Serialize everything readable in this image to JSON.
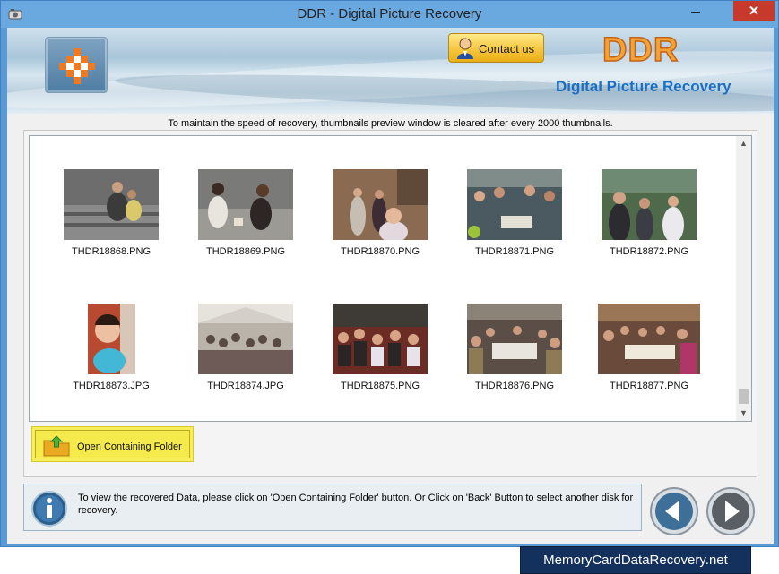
{
  "window": {
    "title": "DDR - Digital Picture Recovery",
    "close_glyph": "✕"
  },
  "banner": {
    "contact_label": "Contact us",
    "brand": "DDR",
    "subtitle": "Digital Picture Recovery"
  },
  "notice": "To maintain the speed of recovery, thumbnails preview window is cleared after every 2000 thumbnails.",
  "thumbnails": [
    {
      "name": "THDR18868.PNG"
    },
    {
      "name": "THDR18869.PNG"
    },
    {
      "name": "THDR18870.PNG"
    },
    {
      "name": "THDR18871.PNG"
    },
    {
      "name": "THDR18872.PNG"
    },
    {
      "name": "THDR18873.JPG"
    },
    {
      "name": "THDR18874.JPG"
    },
    {
      "name": "THDR18875.PNG"
    },
    {
      "name": "THDR18876.PNG"
    },
    {
      "name": "THDR18877.PNG"
    }
  ],
  "open_folder_label": "Open Containing Folder",
  "status_text": "To view the recovered Data, please click on 'Open Containing Folder' button. Or Click on 'Back' Button to select another disk for recovery.",
  "footer_brand": "MemoryCardDataRecovery.net",
  "colors": {
    "accent": "#1a6fc4",
    "brand_orange": "#f4a237",
    "highlight_yellow": "#f7ef5a",
    "close_red": "#c7392b"
  }
}
